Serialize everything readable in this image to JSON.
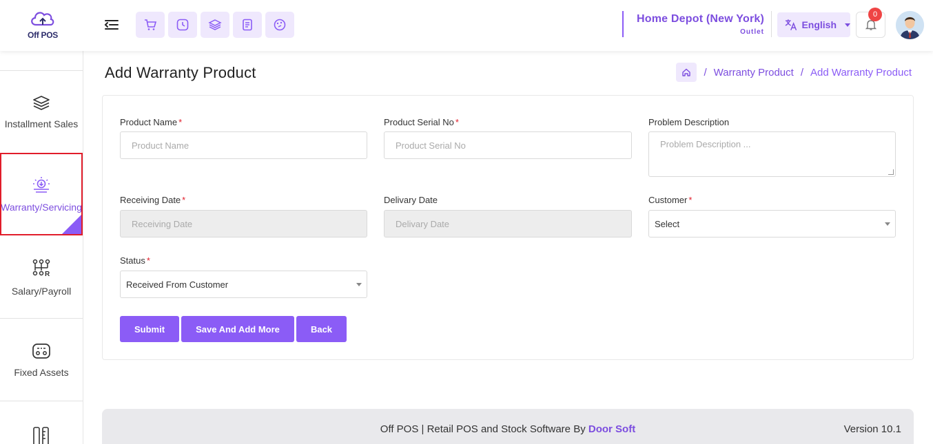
{
  "header": {
    "logo_text": "Off POS",
    "quick_actions": [
      "cart-icon",
      "clock-icon",
      "layers-icon",
      "receipt-icon",
      "palette-icon"
    ],
    "outlet_name": "Home Depot (New York)",
    "outlet_type": "Outlet",
    "language": "English",
    "notification_count": "0",
    "accent_color": "#8b5cf6"
  },
  "sidebar": {
    "items": [
      {
        "label": "Installment Sales",
        "icon": "stack-icon"
      },
      {
        "label": "Warranty/Servicing",
        "icon": "warranty-icon",
        "active": true
      },
      {
        "label": "Salary/Payroll",
        "icon": "payroll-icon"
      },
      {
        "label": "Fixed Assets",
        "icon": "assets-icon"
      }
    ]
  },
  "page": {
    "title": "Add Warranty Product",
    "breadcrumb": {
      "sep": "/",
      "link": "Warranty Product",
      "current": "Add Warranty Product"
    }
  },
  "form": {
    "product_name": {
      "label": "Product Name",
      "placeholder": "Product Name",
      "required": "*"
    },
    "serial_no": {
      "label": "Product Serial No",
      "placeholder": "Product Serial No",
      "required": "*"
    },
    "problem": {
      "label": "Problem Description",
      "placeholder": "Problem Description ..."
    },
    "receiving_date": {
      "label": "Receiving Date",
      "placeholder": "Receiving Date",
      "required": "*"
    },
    "delivery_date": {
      "label": "Delivary Date",
      "placeholder": "Delivary Date"
    },
    "customer": {
      "label": "Customer",
      "value": "Select",
      "required": "*"
    },
    "status": {
      "label": "Status",
      "value": "Received From Customer",
      "required": "*"
    },
    "buttons": {
      "submit": "Submit",
      "save_add": "Save And Add More",
      "back": "Back"
    }
  },
  "footer": {
    "text": "Off POS | Retail POS and Stock Software By ",
    "brand": "Door Soft",
    "version": "Version 10.1"
  }
}
